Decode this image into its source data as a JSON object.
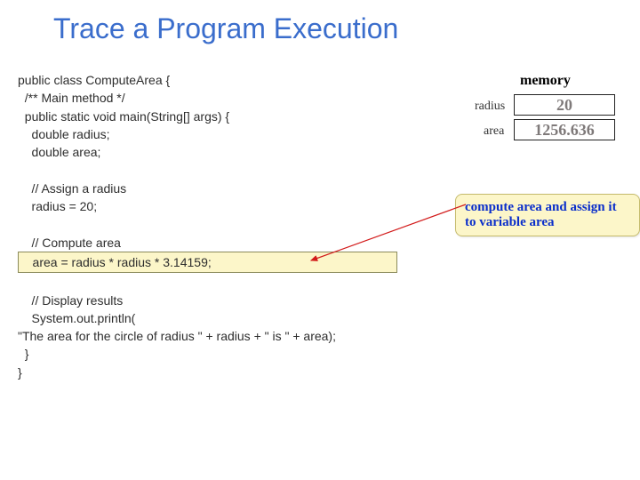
{
  "title": "Trace a Program Execution",
  "memory": {
    "heading": "memory",
    "rows": {
      "radius": {
        "label": "radius",
        "value": "20"
      },
      "area": {
        "label": "area",
        "value": "1256.636"
      }
    }
  },
  "callout": "compute area and assign it to variable area",
  "code": {
    "l1": "public class ComputeArea {",
    "l2": "  /** Main method */",
    "l3": "  public static void main(String[] args) {  ",
    "l4": "    double radius;",
    "l5": "    double area;",
    "blank1": " ",
    "l6": "    // Assign a radius",
    "l7": "    radius = 20;",
    "blank2": " ",
    "l8": "    // Compute area",
    "l9": "    area = radius * radius * 3.14159;    ",
    "blank3": " ",
    "l10": "    // Display results",
    "l11": "    System.out.println(",
    "l12": "\"The area for the circle of radius \" + radius + \" is \" + area);",
    "l13": "  }",
    "l14": "}"
  }
}
